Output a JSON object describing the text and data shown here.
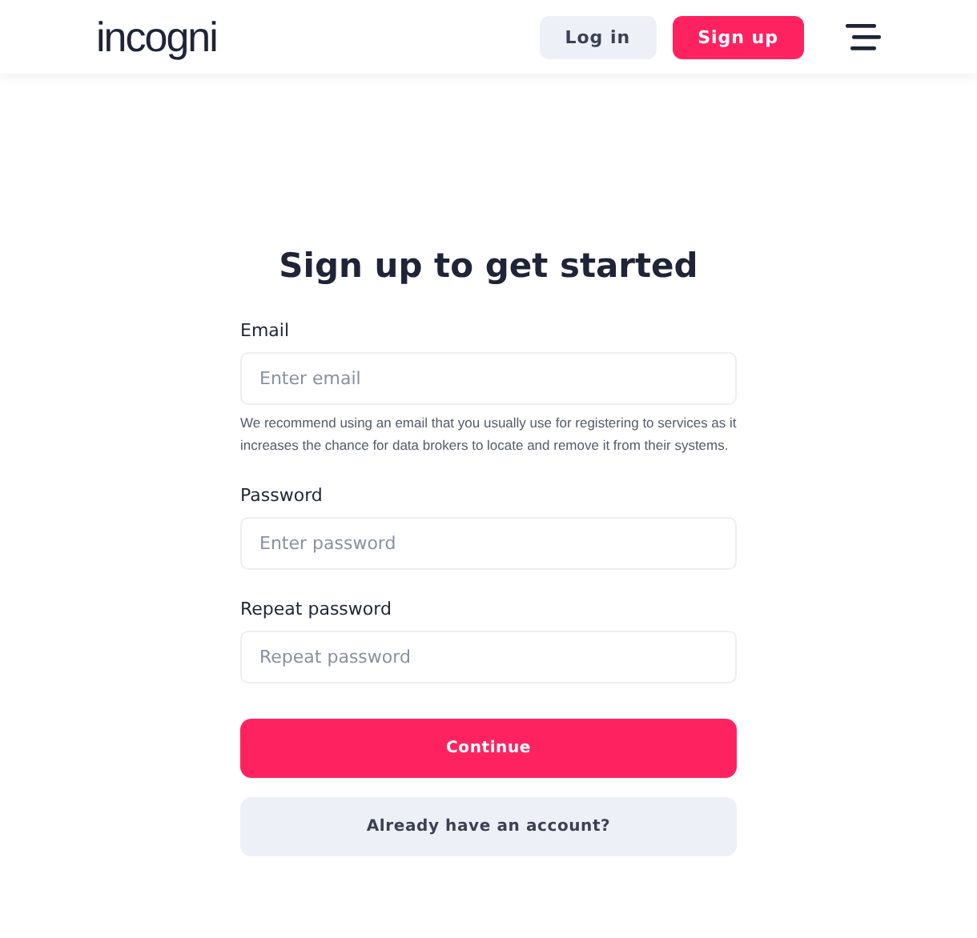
{
  "header": {
    "logo": "incogni",
    "buttons": [
      {
        "label": "Log in",
        "kind": "secondary"
      },
      {
        "label": "Sign up",
        "kind": "primary"
      }
    ]
  },
  "form": {
    "title": "Sign up to get started",
    "fields": [
      {
        "label": "Email",
        "placeholder": "Enter email",
        "hint": "We recommend using an email that you usually use for registering to services as it increases the chance for data brokers to locate and remove it from their systems."
      },
      {
        "label": "Password",
        "placeholder": "Enter password"
      },
      {
        "label": "Repeat password",
        "placeholder": "Repeat password"
      }
    ],
    "buttons": [
      {
        "label": "Continue",
        "kind": "primary"
      },
      {
        "label": "Already have an account?",
        "kind": "secondary"
      }
    ]
  }
}
